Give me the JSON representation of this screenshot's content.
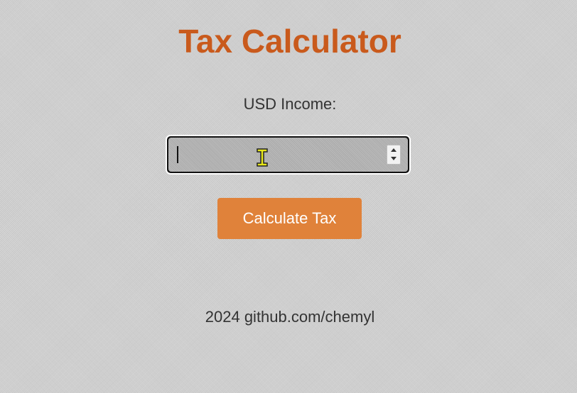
{
  "page": {
    "title": "Tax Calculator",
    "income_label": "USD Income:",
    "income_input": {
      "value": "",
      "type": "number"
    },
    "calculate_button_label": "Calculate Tax",
    "footer_text": "2024 github.com/chemyl"
  },
  "colors": {
    "title": "#c95a1c",
    "button": "#e0823a",
    "input_fill": "#a9a9a9",
    "text": "#333333"
  },
  "icons": {
    "text_cursor": "i-beam-cursor-icon",
    "spinner_up": "spinner-up-icon",
    "spinner_down": "spinner-down-icon"
  }
}
